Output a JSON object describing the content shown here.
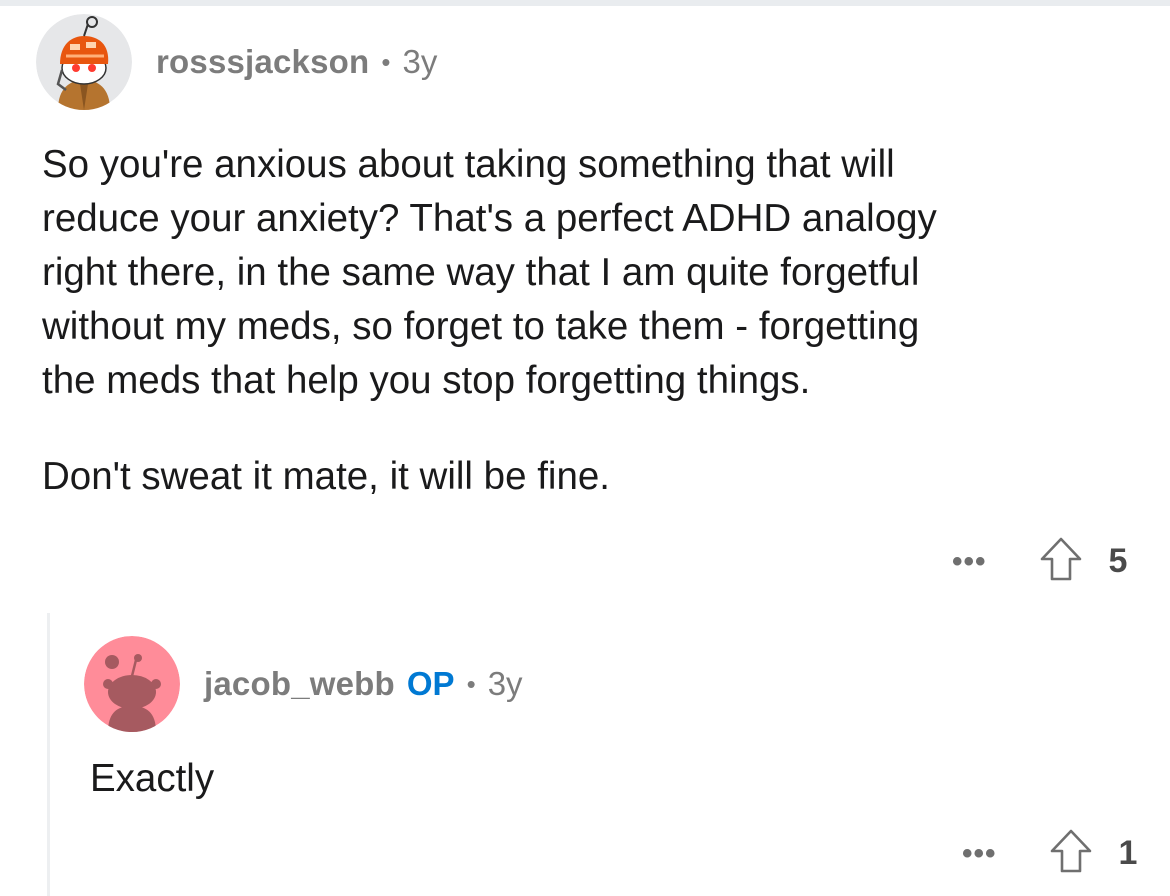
{
  "comments": [
    {
      "username": "rosssjackson",
      "separator": "•",
      "age": "3y",
      "avatar_icon": "snoo-avatar-orange-helmet-icon",
      "paragraphs": [
        "So you're anxious about taking something that will",
        "reduce your anxiety? That's a perfect ADHD analogy",
        "right there, in the same way that I am quite forgetful",
        "without my meds, so forget to take them - forgetting",
        "the meds that help you stop forgetting things."
      ],
      "closing": "Don't sweat it mate, it will be fine.",
      "more_label": "•••",
      "upvote_icon": "upvote-arrow-icon",
      "score": "5"
    },
    {
      "username": "jacob_webb",
      "op_label": "OP",
      "separator": "•",
      "age": "3y",
      "avatar_icon": "snoo-avatar-pink-icon",
      "text": "Exactly",
      "more_label": "•••",
      "upvote_icon": "upvote-arrow-icon",
      "score": "1"
    }
  ],
  "colors": {
    "op_blue": "#0079d3",
    "meta_gray": "#7c7c7c",
    "text": "#1a1a1b",
    "avatar2_bg": "#ff8c99"
  }
}
